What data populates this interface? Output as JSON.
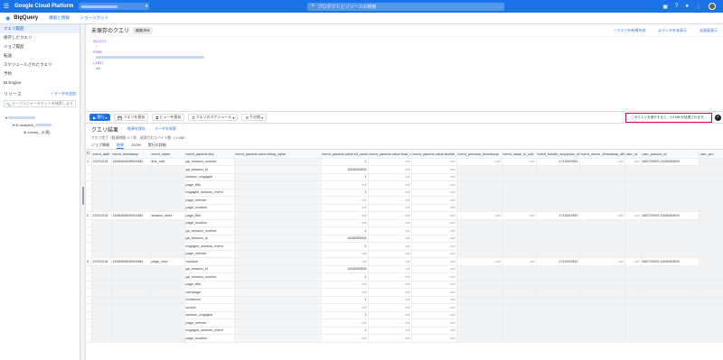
{
  "topbar": {
    "brand": "Google Cloud Platform",
    "search_placeholder": "プロダクトとリソースの検索",
    "menu_icon": "menu-icon"
  },
  "bq_header": {
    "title": "BigQuery",
    "links": [
      "機能と情報",
      "ショートカット"
    ]
  },
  "sidebar": {
    "items": [
      "クエリ履歴",
      "保存したクエリ",
      "ジョブ履歴",
      "転送",
      "スケジュールされたクエリ",
      "予約",
      "BI Engine"
    ],
    "resources_label": "リソース",
    "add_data_label": "+ データを追加",
    "search_placeholder": "テーブルとデータセットを検索します",
    "tree": [
      "analytics_",
      "events_ (9 個)"
    ]
  },
  "editor": {
    "title": "未保存のクエリ",
    "badge": "編集済み",
    "actions": [
      "+ クエリを新規作成",
      "エディタを非表示",
      "全画面表示"
    ],
    "lines": [
      "SELECT",
      "*",
      "FROM",
      "LIMIT",
      "10"
    ]
  },
  "toolbar": {
    "run": "実行",
    "save_query": "クエリを保存",
    "save_view": "ビューを保存",
    "schedule": "クエリのスケジュール",
    "more": "その他",
    "validator": "このクエリを実行すると、1.3 MB が処理されます。"
  },
  "results": {
    "title": "クエリ結果",
    "save_link": "結果を保存",
    "explore_link": "データを探索",
    "info": "クエリ完了（経過時間: 0.7 秒、処理されたバイト数: 1.3 MB）",
    "tabs": [
      "ジョブ情報",
      "結果",
      "JSON",
      "実行の詳細"
    ],
    "columns": [
      "行",
      "event_date",
      "event_timestamp",
      "event_name",
      "event_params.key",
      "event_params.value.string_value",
      "event_params.value.int_value",
      "event_params.value.float_value",
      "event_params.value.double_value",
      "event_previous_timestamp",
      "event_value_in_usd",
      "event_bundle_sequence_id",
      "event_server_timestamp_offset",
      "user_id",
      "user_pseudo_id",
      "user_pro"
    ],
    "rows": [
      {
        "n": "1",
        "date": "20201218",
        "ts": "1608260808924384",
        "name": "first_visit",
        "seq": "1715002592",
        "pseudo": "680723092.1608260809",
        "params": [
          [
            "ga_session_number",
            "1"
          ],
          [
            "ga_session_id",
            "1608260808"
          ],
          [
            "session_engaged",
            "1"
          ],
          [
            "page_title",
            ""
          ],
          [
            "engaged_session_event",
            "1"
          ],
          [
            "page_referrer",
            ""
          ],
          [
            "page_location",
            ""
          ]
        ]
      },
      {
        "n": "2",
        "date": "20201218",
        "ts": "1608260808924384",
        "name": "session_start",
        "seq": "1715002592",
        "pseudo": "680723092.1608260809",
        "params": [
          [
            "page_title",
            ""
          ],
          [
            "page_location",
            ""
          ],
          [
            "ga_session_number",
            "1"
          ],
          [
            "ga_session_id",
            "1608260808"
          ],
          [
            "engaged_session_event",
            "1"
          ],
          [
            "page_referrer",
            ""
          ]
        ]
      },
      {
        "n": "3",
        "date": "20201218",
        "ts": "1608260808924384",
        "name": "page_view",
        "seq": "1715002592",
        "pseudo": "680723092.1608260809",
        "params": [
          [
            "medium",
            ""
          ],
          [
            "ga_session_id",
            "1608260808"
          ],
          [
            "ga_session_number",
            "1"
          ],
          [
            "page_title",
            ""
          ],
          [
            "campaign",
            ""
          ],
          [
            "entrances",
            "1"
          ],
          [
            "source",
            ""
          ],
          [
            "session_engaged",
            "1"
          ],
          [
            "page_referrer",
            ""
          ],
          [
            "engaged_session_event",
            "1"
          ],
          [
            "page_location",
            ""
          ]
        ]
      }
    ],
    "null_label": "null"
  }
}
